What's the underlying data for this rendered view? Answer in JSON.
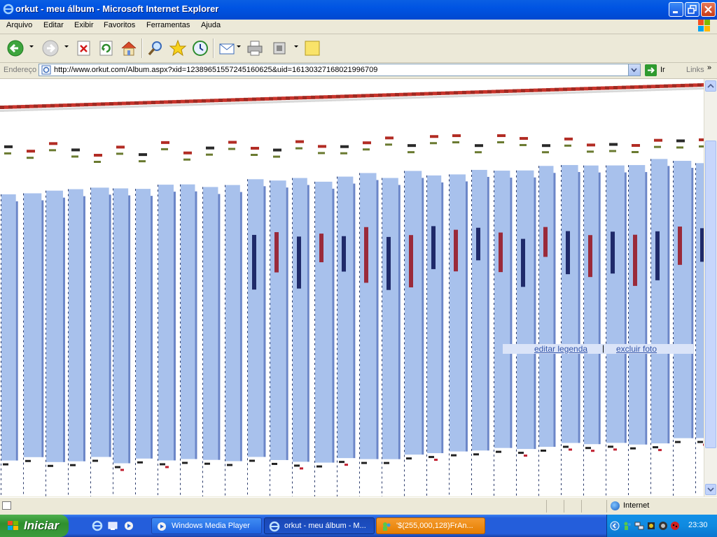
{
  "window": {
    "title": "orkut - meu álbum - Microsoft Internet Explorer"
  },
  "menu": [
    "Arquivo",
    "Editar",
    "Exibir",
    "Favoritos",
    "Ferramentas",
    "Ajuda"
  ],
  "address": {
    "label": "Endereço",
    "url": "http://www.orkut.com/Album.aspx?xid=12389651557245160625&uid=16130327168021996709",
    "go_label": "Ir",
    "links_label": "Links",
    "links_chevron": "»"
  },
  "content": {
    "edit_caption_link": "editar legenda",
    "separator": "|",
    "delete_photo_link": "excluir foto"
  },
  "status": {
    "zone": "Internet"
  },
  "taskbar": {
    "start_label": "Iniciar",
    "tasks": [
      {
        "label": "Windows Media Player",
        "state": "normal"
      },
      {
        "label": "orkut - meu álbum - M...",
        "state": "active"
      },
      {
        "label": "'$(255,000,128)FrAn...",
        "state": "flash"
      }
    ],
    "clock": "23:30"
  },
  "colors": {
    "accent": "#0054e3",
    "link": "#3355aa",
    "start_green": "#3c9c3c",
    "task_flash": "#e57e00"
  }
}
